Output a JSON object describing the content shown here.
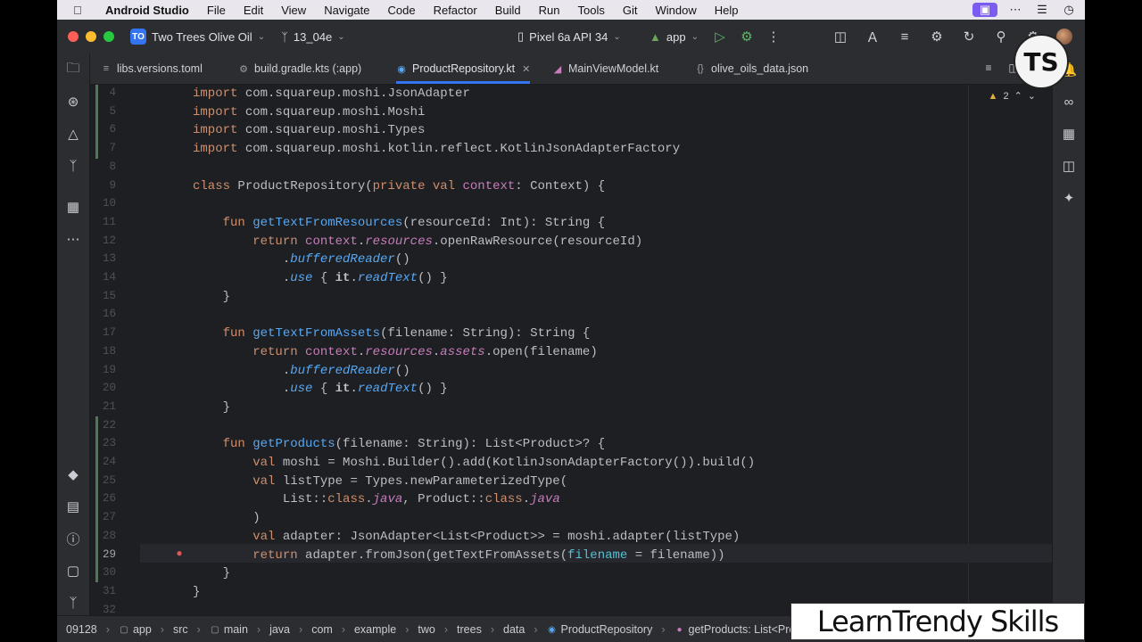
{
  "menubar": {
    "app_name": "Android Studio",
    "items": [
      "File",
      "Edit",
      "View",
      "Navigate",
      "Code",
      "Refactor",
      "Build",
      "Run",
      "Tools",
      "Git",
      "Window",
      "Help"
    ]
  },
  "titlebar": {
    "project_badge": "TO",
    "project_name": "Two Trees Olive Oil",
    "branch": "13_04e",
    "device": "Pixel 6a API 34",
    "run_config": "app"
  },
  "tabs": [
    {
      "label": "libs.versions.toml",
      "icon": "toml-file-icon"
    },
    {
      "label": "build.gradle.kts (:app)",
      "icon": "gradle-icon"
    },
    {
      "label": "ProductRepository.kt",
      "icon": "kotlin-class-icon",
      "active": true
    },
    {
      "label": "MainViewModel.kt",
      "icon": "kotlin-file-icon"
    },
    {
      "label": "olive_oils_data.json",
      "icon": "json-file-icon"
    }
  ],
  "editor": {
    "warnings_count": "2",
    "line_numbers": [
      "4",
      "5",
      "6",
      "7",
      "8",
      "9",
      "10",
      "11",
      "12",
      "13",
      "14",
      "15",
      "16",
      "17",
      "18",
      "19",
      "20",
      "21",
      "22",
      "23",
      "24",
      "25",
      "26",
      "27",
      "28",
      "29",
      "30",
      "31",
      "32"
    ],
    "current_line": "29"
  },
  "statusbar": {
    "position": "09128",
    "breadcrumb": [
      "app",
      "src",
      "main",
      "java",
      "com",
      "example",
      "two",
      "trees",
      "data",
      "ProductRepository",
      "getProducts: List<Product"
    ]
  },
  "watermark": "LearnTrendy Skills",
  "logo_text": "TS",
  "colors": {
    "editor_bg": "#1e1f22",
    "accent": "#3574f0",
    "keyword": "#cf8e6d",
    "function": "#56a8f5",
    "property": "#c77dbb"
  }
}
